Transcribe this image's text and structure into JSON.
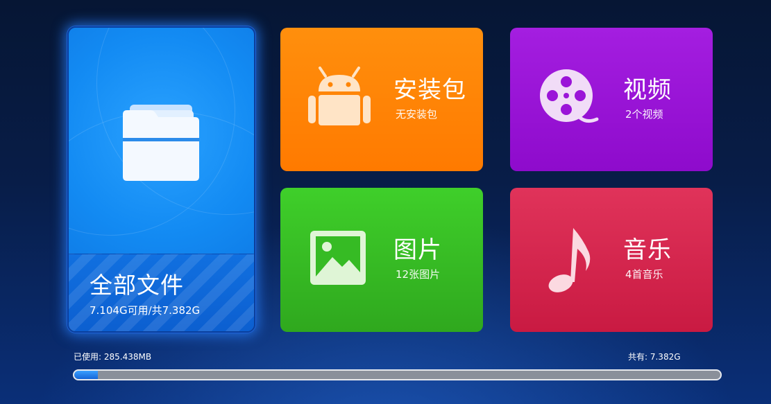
{
  "tiles": {
    "all_files": {
      "title": "全部文件",
      "subtitle": "7.104G可用/共7.382G",
      "icon": "folder-icon",
      "color": "#138bf3"
    },
    "apk": {
      "title": "安装包",
      "subtitle": "无安装包",
      "icon": "android-icon",
      "color": "#ff8505"
    },
    "video": {
      "title": "视频",
      "subtitle": "2个视频",
      "icon": "film-reel-icon",
      "color": "#9b14d8"
    },
    "image": {
      "title": "图片",
      "subtitle": "12张图片",
      "icon": "picture-icon",
      "color": "#36bb24"
    },
    "music": {
      "title": "音乐",
      "subtitle": "4首音乐",
      "icon": "music-note-icon",
      "color": "#d5264e"
    }
  },
  "storage": {
    "used_label": "已使用: 285.438MB",
    "total_label": "共有: 7.382G",
    "used_fraction": 0.037
  }
}
